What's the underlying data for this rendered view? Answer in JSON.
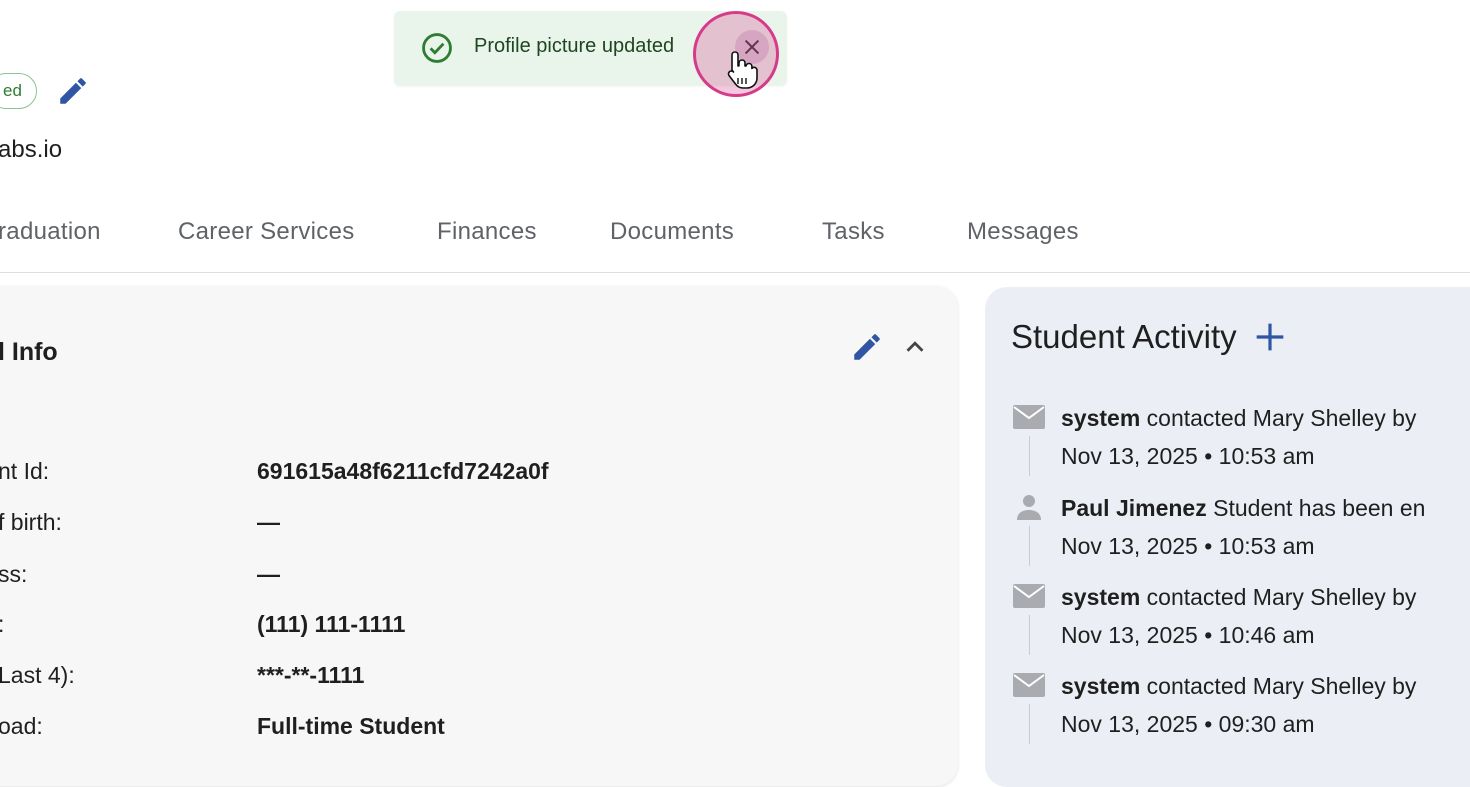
{
  "header": {
    "status_chip": "ed",
    "email_partial": "abs.io"
  },
  "tabs": [
    {
      "label": "raduation"
    },
    {
      "label": "Career Services"
    },
    {
      "label": "Finances"
    },
    {
      "label": "Documents"
    },
    {
      "label": "Tasks"
    },
    {
      "label": "Messages"
    }
  ],
  "info_card": {
    "title": "l Info",
    "rows": [
      {
        "label": "nt Id:",
        "value": "691615a48f6211cfd7242a0f"
      },
      {
        "label": "f birth:",
        "value": "—"
      },
      {
        "label": "ss:",
        "value": "—"
      },
      {
        "label": ":",
        "value": "(111) 111-1111"
      },
      {
        "label": "Last 4):",
        "value": "***-**-1111"
      },
      {
        "label": "oad:",
        "value": "Full-time Student"
      }
    ]
  },
  "activity": {
    "title": "Student Activity",
    "items": [
      {
        "icon": "mail-icon",
        "actor": "system",
        "text": " contacted Mary Shelley by",
        "time": "Nov 13, 2025 • 10:53 am"
      },
      {
        "icon": "person-icon",
        "actor": "Paul Jimenez",
        "text": " Student has been en",
        "time": "Nov 13, 2025 • 10:53 am"
      },
      {
        "icon": "mail-icon",
        "actor": "system",
        "text": " contacted Mary Shelley by",
        "time": "Nov 13, 2025 • 10:46 am"
      },
      {
        "icon": "mail-icon",
        "actor": "system",
        "text": " contacted Mary Shelley by",
        "time": "Nov 13, 2025 • 09:30 am"
      }
    ]
  },
  "toast": {
    "message": "Profile picture updated",
    "icon": "check-circle-icon",
    "close_icon": "close-icon"
  },
  "colors": {
    "accent": "#2f55a4",
    "success": "#2e7d32",
    "toast_bg": "#e9f5ea",
    "activity_bg": "#ebeef5",
    "cursor_highlight": "#d63a8a"
  }
}
